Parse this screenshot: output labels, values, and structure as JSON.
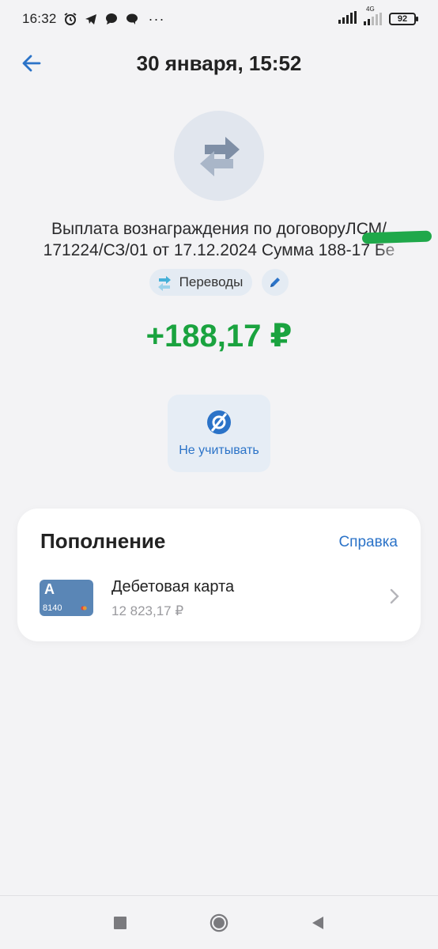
{
  "status_bar": {
    "time": "16:32",
    "icons": [
      "alarm-icon",
      "telegram-icon",
      "chat-icon",
      "messages-icon"
    ],
    "more": "···",
    "network": "4G",
    "battery": "92"
  },
  "header": {
    "title": "30 января, 15:52",
    "back_icon": "arrow-left-icon"
  },
  "transaction": {
    "category_icon": "transfer-arrows-icon",
    "description": "Выплата вознаграждения по договоруЛСМ/\n171224/СЗ/01 от 17.12.2024 Сумма 188-17 Бе",
    "category_label": "Переводы",
    "amount": "+188,17 ₽",
    "exclude_label": "Не учитывать"
  },
  "colors": {
    "amount": "#1aa33f",
    "accent": "#2b73c8",
    "card": "#5a86b6"
  },
  "card_section": {
    "title": "Пополнение",
    "link": "Справка",
    "account": {
      "thumb_letter": "А",
      "thumb_digits": "8140",
      "name": "Дебетовая карта",
      "balance": "12 823,17 ₽"
    }
  },
  "nav": {
    "icons": [
      "recents-square-icon",
      "home-circle-icon",
      "back-triangle-icon"
    ]
  }
}
